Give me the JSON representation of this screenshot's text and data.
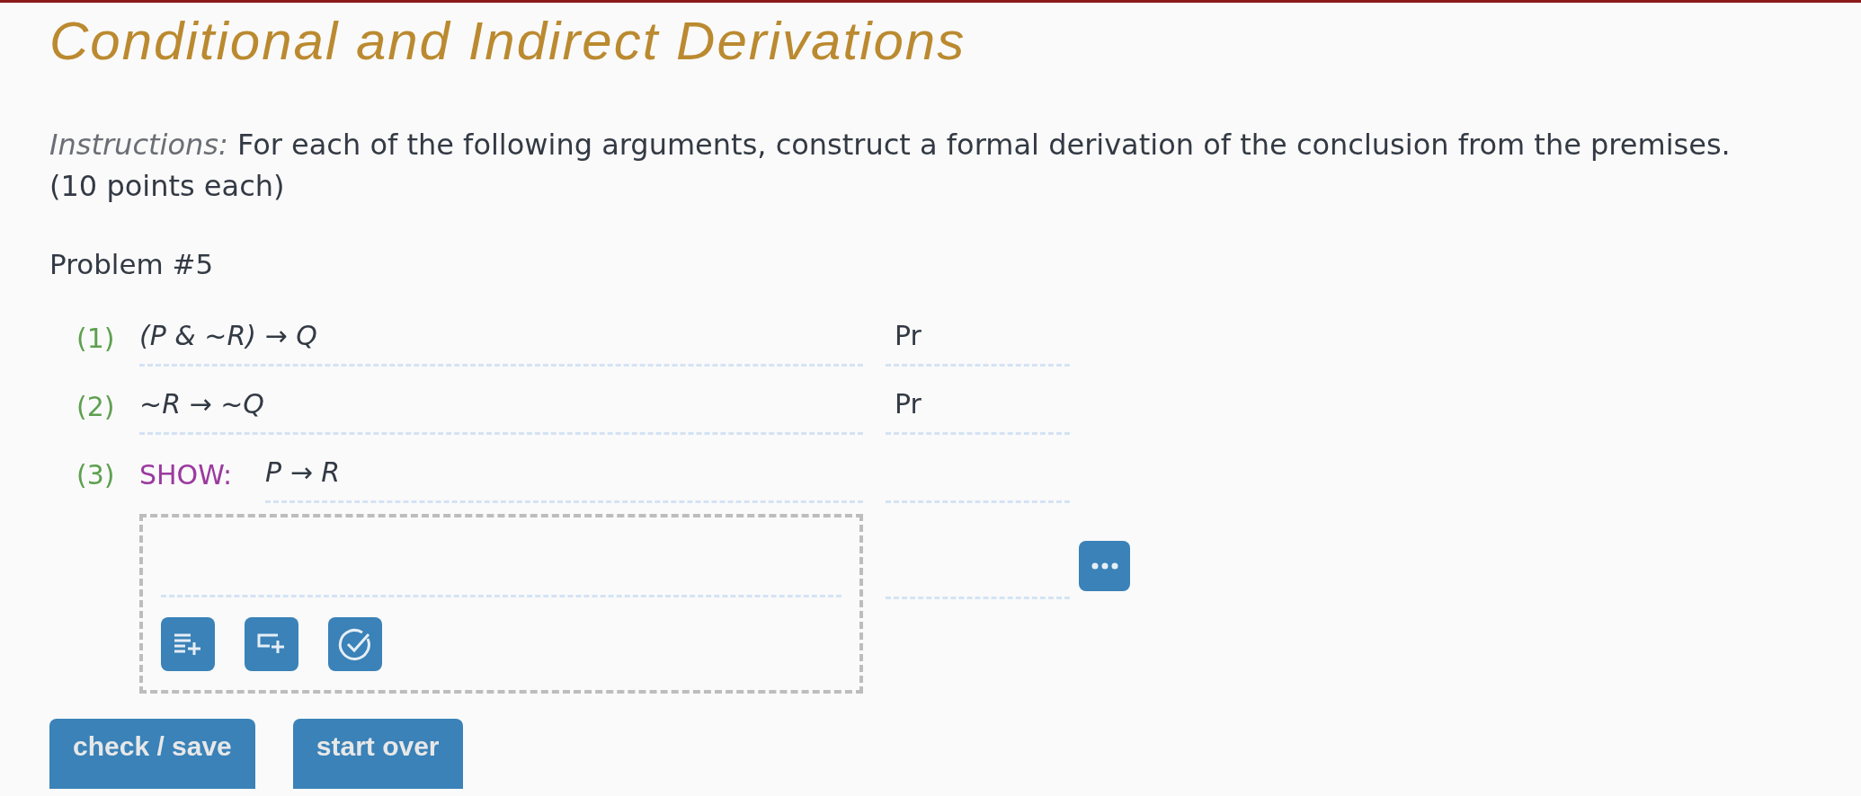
{
  "title": "Conditional and Indirect Derivations",
  "instructions": {
    "label": "Instructions:",
    "text": "For each of the following arguments, construct a formal derivation of the conclusion from the premises. (10 points each)"
  },
  "problem": {
    "label": "Problem #5",
    "lines": [
      {
        "number": "(1)",
        "kind": "premise",
        "formula": "(P & ~R) → Q",
        "justification": "Pr"
      },
      {
        "number": "(2)",
        "kind": "premise",
        "formula": "~R → ~Q",
        "justification": "Pr"
      },
      {
        "number": "(3)",
        "kind": "show",
        "keyword": "SHOW:",
        "formula": "P → R"
      }
    ],
    "subproof": {
      "lines": [
        {
          "kind": "blank"
        }
      ],
      "tools": [
        {
          "kind": "add-line"
        },
        {
          "kind": "add-subproof"
        },
        {
          "kind": "check"
        }
      ]
    }
  },
  "actions": [
    "check / save",
    "start over"
  ]
}
